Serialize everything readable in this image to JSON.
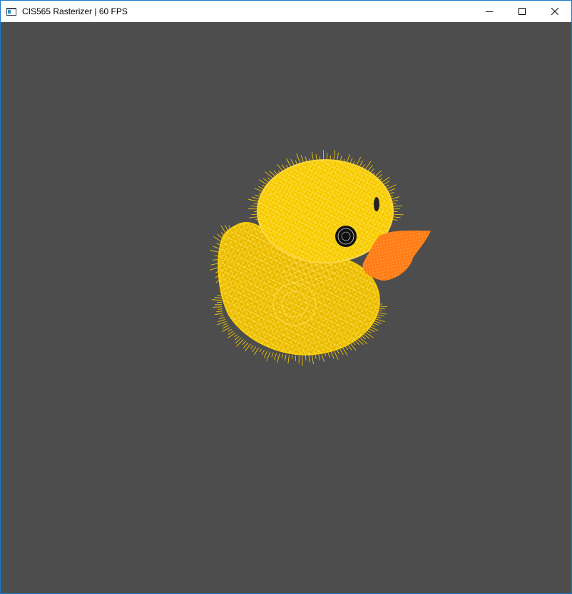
{
  "window": {
    "title": "CIS565 Rasterizer | 60 FPS",
    "icons": {
      "app": "app-window-icon",
      "minimize": "minimize-icon",
      "maximize": "maximize-icon",
      "close": "close-icon"
    }
  },
  "scene": {
    "model": "duck",
    "render_mode": "wireframe",
    "background_color": "#4d4d4d",
    "colors": {
      "body": "#ffd200",
      "body_shade": "#e6b400",
      "beak": "#ff7a10",
      "eye": "#111111"
    }
  }
}
